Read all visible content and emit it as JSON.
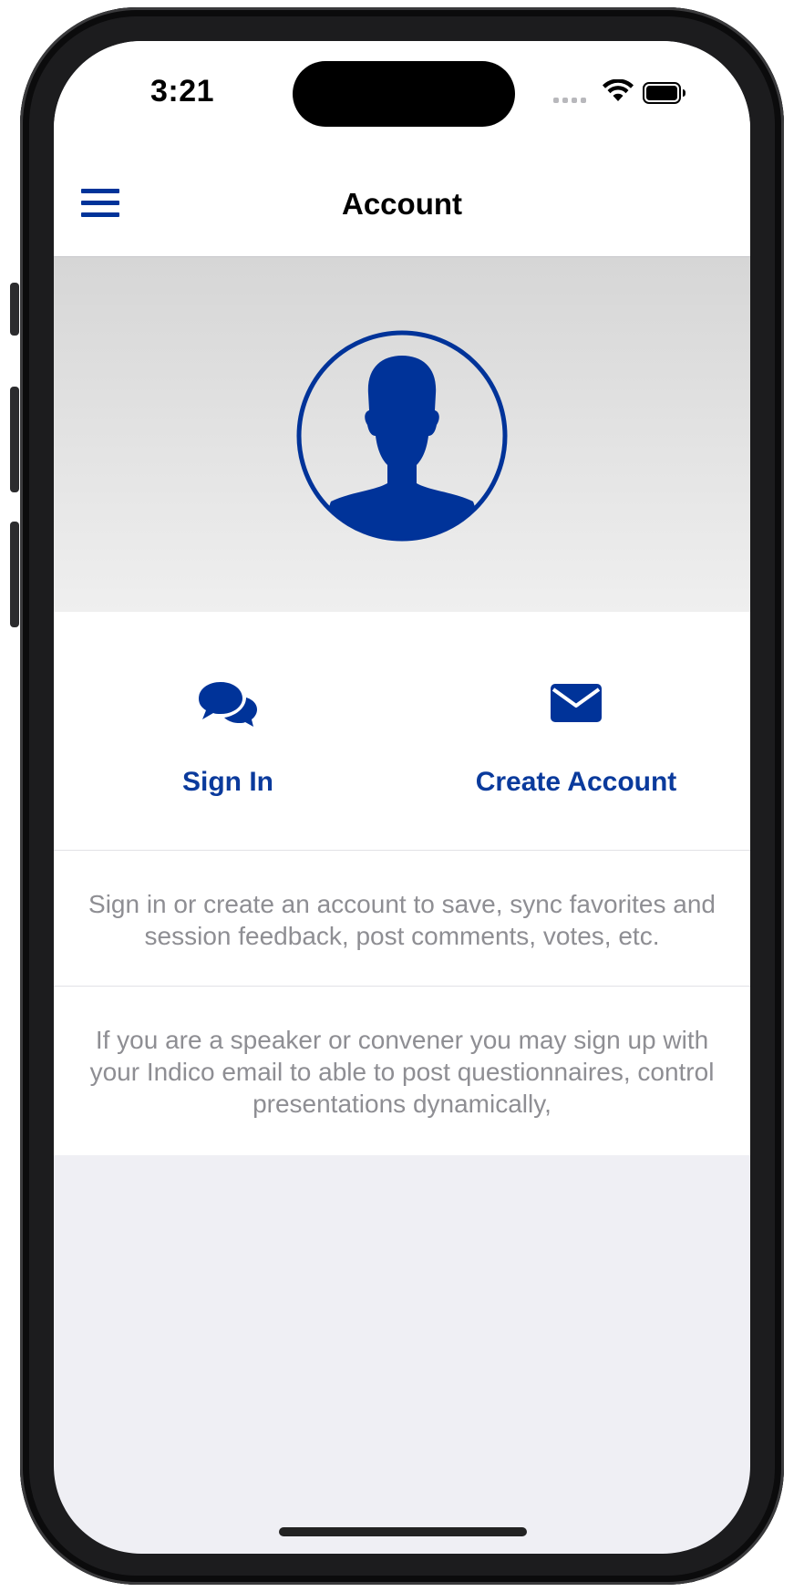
{
  "status_bar": {
    "time": "3:21",
    "signal_icon": "cellular-dots-icon",
    "wifi_icon": "wifi-icon",
    "battery_icon": "battery-full-icon"
  },
  "navbar": {
    "title": "Account",
    "menu_icon": "hamburger-menu-icon"
  },
  "hero": {
    "avatar_icon": "user-silhouette-icon"
  },
  "actions": [
    {
      "label": "Sign In",
      "icon": "chat-bubbles-icon"
    },
    {
      "label": "Create Account",
      "icon": "envelope-icon"
    }
  ],
  "info": {
    "text1": "Sign in or create an account to save, sync favorites and session feedback, post comments, votes, etc.",
    "text2": "If you are a speaker or convener you may sign up with your Indico email to able to post questionnaires, control presentations dynamically,"
  },
  "colors": {
    "accent": "#003399",
    "link_text": "#0A3A9C",
    "secondary_text": "#8E8E93",
    "background": "#EFEFF4"
  }
}
